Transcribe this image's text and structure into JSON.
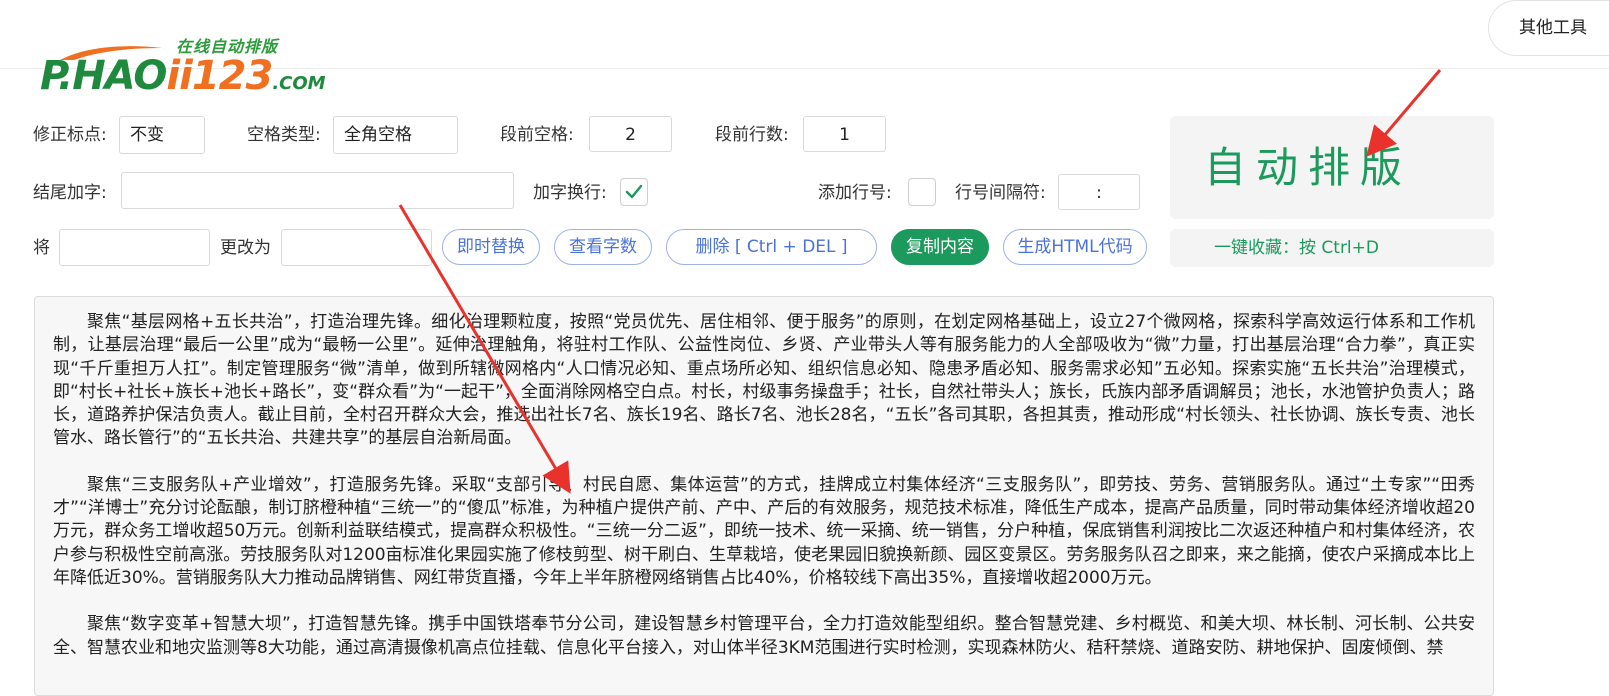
{
  "header": {
    "logo_sub": "在线自动排版",
    "logo_main_prefix": "P.HAO",
    "logo_main_suffix": "ii123",
    "logo_tld": ".COM",
    "other_tools_label": "其他工具"
  },
  "options": {
    "fix_punct_label": "修正标点:",
    "fix_punct_value": "不变",
    "space_type_label": "空格类型:",
    "space_type_value": "全角空格",
    "para_indent_label": "段前空格:",
    "para_indent_value": "2",
    "para_lines_label": "段前行数:",
    "para_lines_value": "1",
    "suffix_label": "结尾加字:",
    "suffix_value": "",
    "add_newline_label": "加字换行:",
    "add_newline_checked": true,
    "line_numbers_label": "添加行号:",
    "line_numbers_checked": false,
    "line_sep_label": "行号间隔符:",
    "line_sep_value": ":"
  },
  "replace": {
    "from_label": "将",
    "from_value": "",
    "to_label": "更改为",
    "to_value": ""
  },
  "buttons": {
    "instant_replace": "即时替换",
    "word_count": "查看字数",
    "delete": "删除 [ Ctrl + DEL ]",
    "copy": "复制内容",
    "gen_html": "生成HTML代码"
  },
  "auto_format": {
    "label": "自动排版",
    "favorite_hint": "一键收藏：按 Ctrl+D"
  },
  "content": {
    "paragraphs": [
      "聚焦“基层网格+五长共治”，打造治理先锋。细化治理颗粒度，按照“党员优先、居住相邻、便于服务”的原则，在划定网格基础上，设立27个微网格，探索科学高效运行体系和工作机制，让基层治理“最后一公里”成为“最畅一公里”。延伸治理触角，将驻村工作队、公益性岗位、乡贤、产业带头人等有服务能力的人全部吸收为“微”力量，打出基层治理“合力拳”，真正实现“千斤重担万人扛”。制定管理服务“微”清单，做到所辖微网格内“人口情况必知、重点场所必知、组织信息必知、隐患矛盾必知、服务需求必知”五必知。探索实施“五长共治”治理模式，即“村长+社长+族长+池长+路长”，变“群众看”为“一起干”，全面消除网格空白点。村长，村级事务操盘手；社长，自然社带头人；族长，氏族内部矛盾调解员；池长，水池管护负责人；路长，道路养护保洁负责人。截止目前，全村召开群众大会，推选出社长7名、族长19名、路长7名、池长28名，“五长”各司其职，各担其责，推动形成“村长领头、社长协调、族长专责、池长管水、路长管行”的“五长共治、共建共享”的基层自治新局面。",
      "聚焦“三支服务队+产业增效”，打造服务先锋。采取“支部引导、村民自愿、集体运营”的方式，挂牌成立村集体经济“三支服务队”，即劳技、劳务、营销服务队。通过“土专家”“田秀才”“洋博士”充分讨论酝酿，制订脐橙种植“三统一”的“傻瓜”标准，为种植户提供产前、产中、产后的有效服务，规范技术标准，降低生产成本，提高产品质量，同时带动集体经济增收超20万元，群众务工增收超50万元。创新利益联结模式，提高群众积极性。“三统一分二返”，即统一技术、统一采摘、统一销售，分户种植，保底销售利润按比二次返还种植户和村集体经济，农户参与积极性空前高涨。劳技服务队对1200亩标准化果园实施了修枝剪型、树干刷白、生草栽培，使老果园旧貌换新颜、园区变景区。劳务服务队召之即来，来之能摘，使农户采摘成本比上年降低近30%。营销服务队大力推动品牌销售、网红带货直播，今年上半年脐橙网络销售占比40%，价格较线下高出35%，直接增收超2000万元。",
      "聚焦“数字变革+智慧大坝”，打造智慧先锋。携手中国铁塔奉节分公司，建设智慧乡村管理平台，全力打造效能型组织。整合智慧党建、乡村概览、和美大坝、林长制、河长制、公共安全、智慧农业和地灾监测等8大功能，通过高清摄像机高点位挂载、信息化平台接入，对山体半径3KM范围进行实时检测，实现森林防火、秸秆禁烧、道路安防、耕地保护、固废倾倒、禁"
    ]
  }
}
